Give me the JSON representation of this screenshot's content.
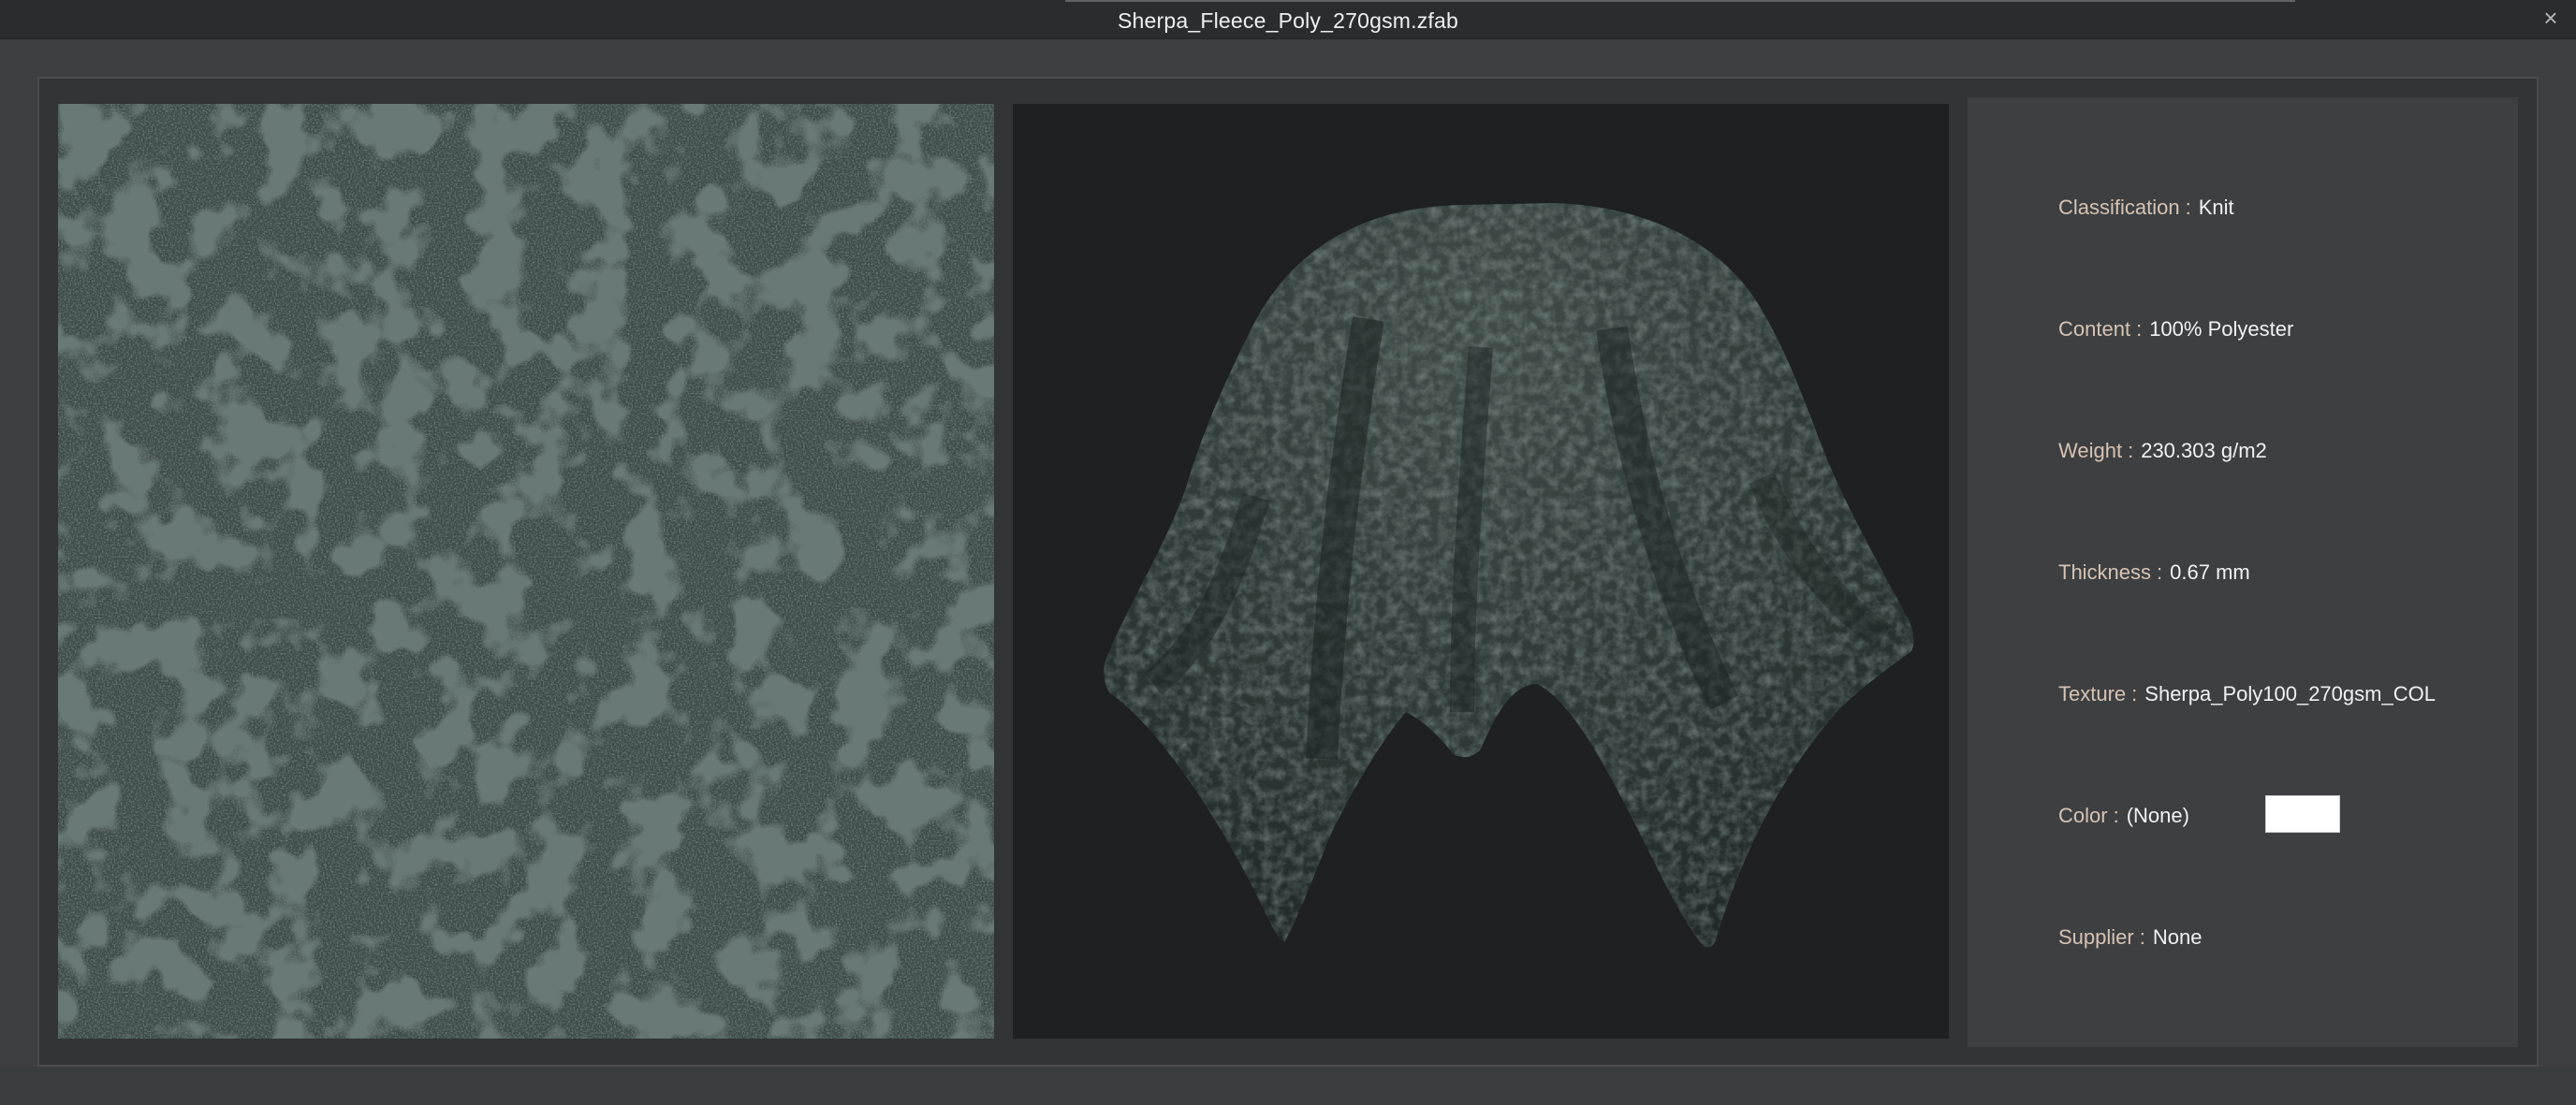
{
  "window": {
    "title": "Sherpa_Fleece_Poly_270gsm.zfab",
    "close_glyph": "×"
  },
  "fabric_swatch": {
    "icon": "fabric-texture-tile",
    "color": "#3c4b47"
  },
  "fabric_preview": {
    "icon": "draped-fabric-preview",
    "background": "#1f2022",
    "fabric_color": "#34403c"
  },
  "properties": [
    {
      "key": "classification",
      "label": "Classification",
      "separator": ":",
      "value": "Knit"
    },
    {
      "key": "content",
      "label": "Content",
      "separator": ":",
      "value": "100% Polyester"
    },
    {
      "key": "weight",
      "label": "Weight",
      "separator": ":",
      "value": "230.303 g/m2"
    },
    {
      "key": "thickness",
      "label": "Thickness",
      "separator": ":",
      "value": "0.67 mm"
    },
    {
      "key": "texture",
      "label": "Texture",
      "separator": ":",
      "value": "Sherpa_Poly100_270gsm_COL"
    },
    {
      "key": "color",
      "label": "Color",
      "separator": ":",
      "value": "(None)",
      "chip_color": "#ffffff"
    },
    {
      "key": "supplier",
      "label": "Supplier",
      "separator": ":",
      "value": "None"
    }
  ]
}
